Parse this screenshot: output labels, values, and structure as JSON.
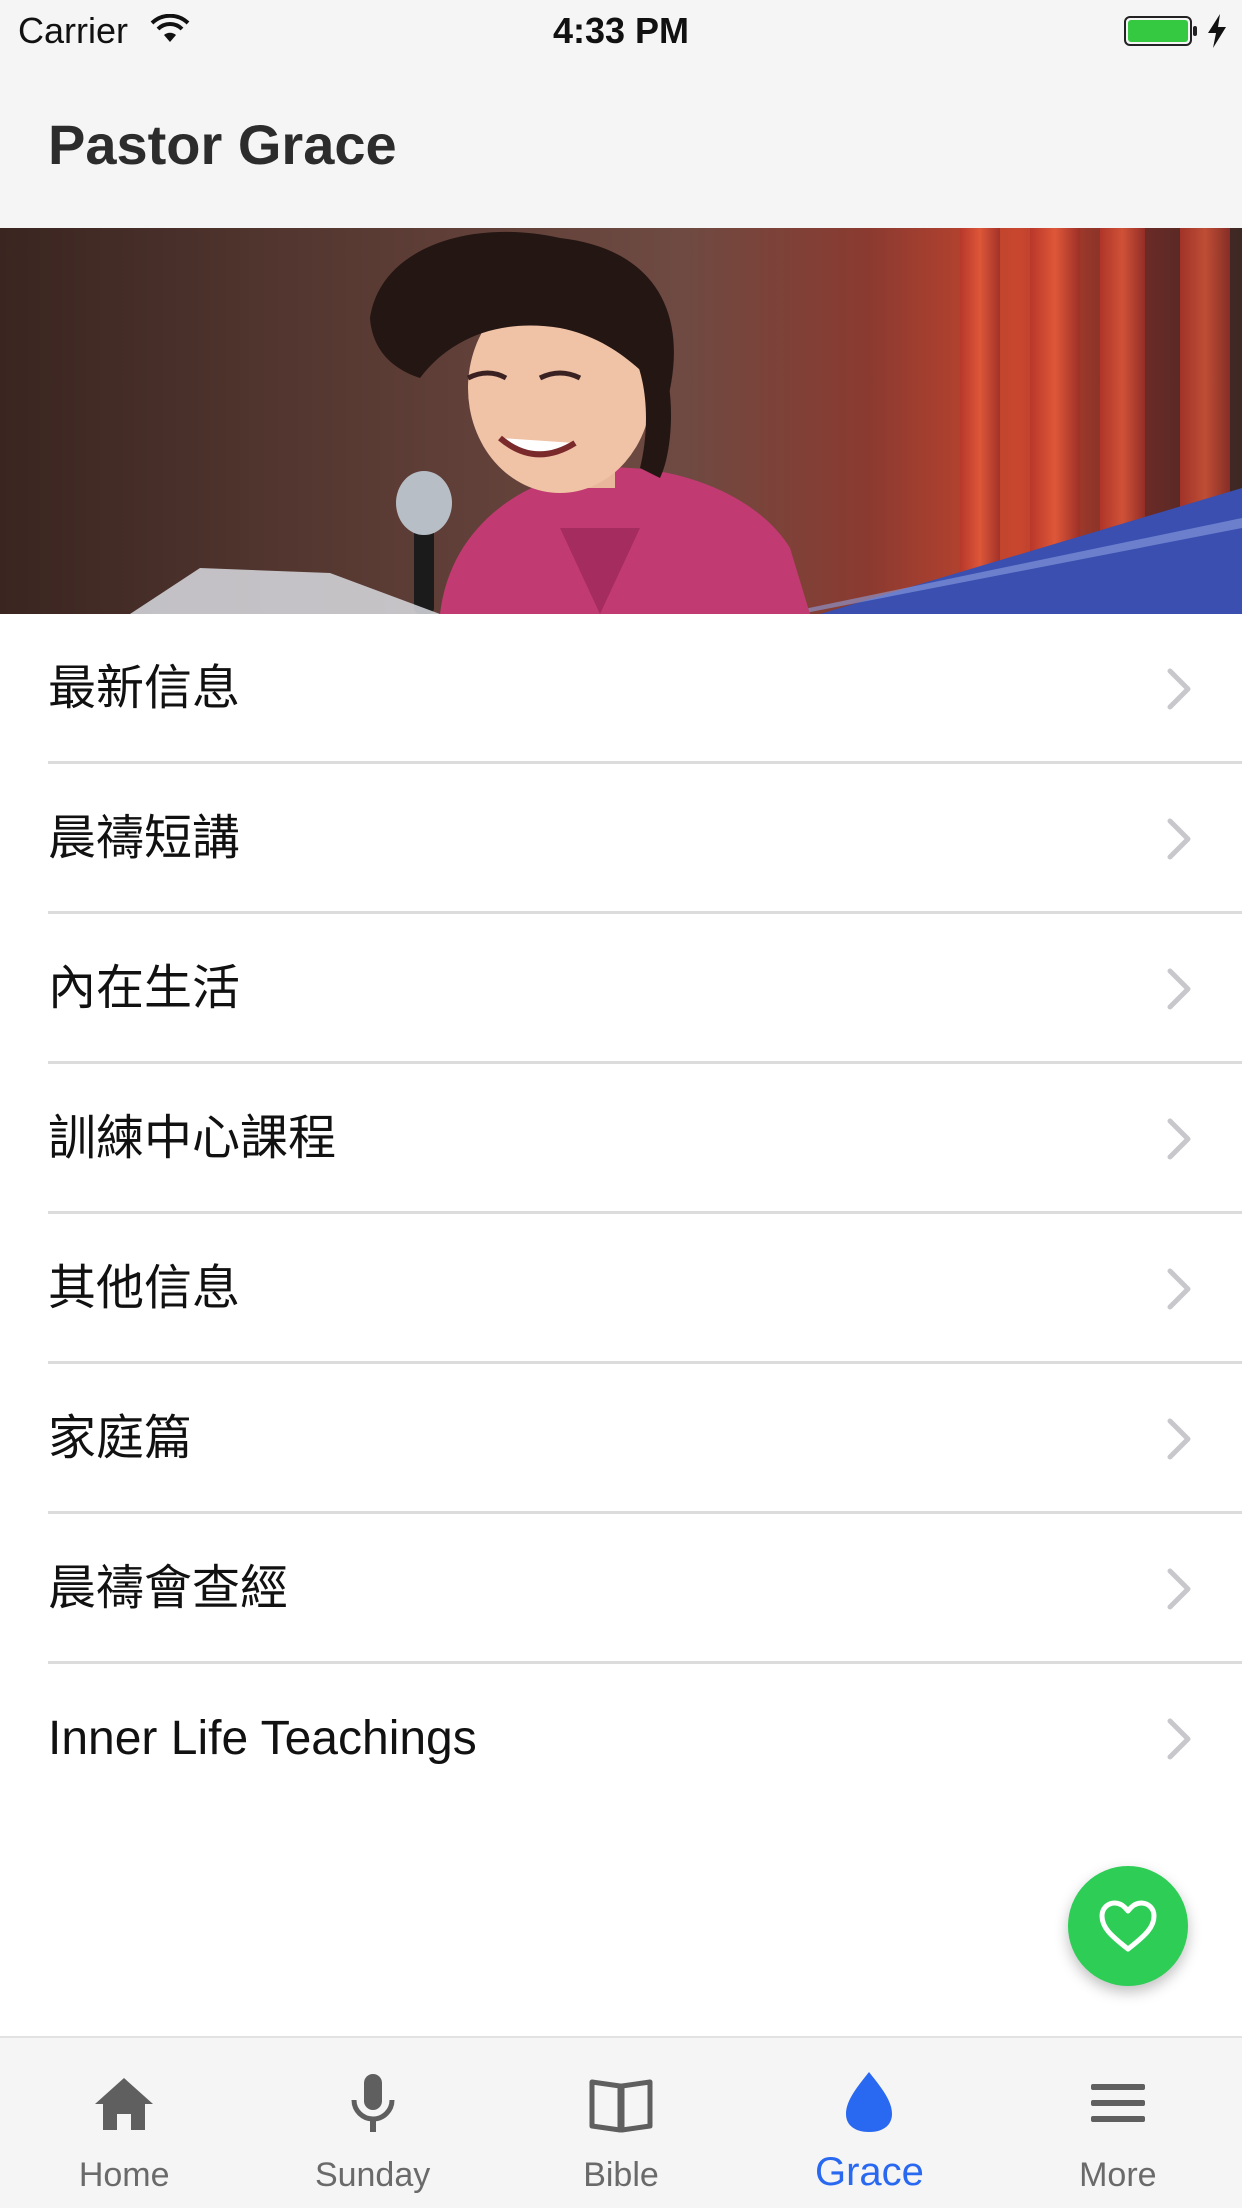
{
  "status_bar": {
    "carrier": "Carrier",
    "time": "4:33 PM",
    "battery_color": "#34c940"
  },
  "header": {
    "title": "Pastor Grace"
  },
  "hero": {
    "image": "pastor-speaking-at-podium-photo"
  },
  "menu": {
    "items": [
      {
        "label": "最新信息"
      },
      {
        "label": "晨禱短講"
      },
      {
        "label": "內在生活"
      },
      {
        "label": "訓練中心課程"
      },
      {
        "label": "其他信息"
      },
      {
        "label": "家庭篇"
      },
      {
        "label": "晨禱會查經"
      },
      {
        "label": "Inner Life Teachings"
      }
    ]
  },
  "fab": {
    "icon": "heart-icon",
    "color": "#2dcd56"
  },
  "tab_bar": {
    "active_color": "#2968f0",
    "tabs": [
      {
        "label": "Home",
        "icon": "home-icon"
      },
      {
        "label": "Sunday",
        "icon": "microphone-icon"
      },
      {
        "label": "Bible",
        "icon": "book-icon"
      },
      {
        "label": "Grace",
        "icon": "drop-icon",
        "active": true
      },
      {
        "label": "More",
        "icon": "menu-icon"
      }
    ]
  }
}
